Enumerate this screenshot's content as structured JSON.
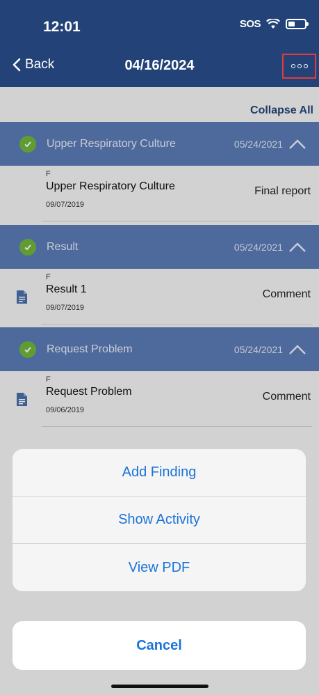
{
  "status_bar": {
    "time": "12:01",
    "carrier": "SOS"
  },
  "nav": {
    "back_label": "Back",
    "title": "04/16/2024",
    "more_icon": "ellipsis-icon"
  },
  "colors": {
    "header": "#234378",
    "section": "#5a7ab4",
    "accent": "#1a73d9",
    "check": "#6fb43a",
    "highlight": "#e23b3b"
  },
  "collapse_all_label": "Collapse All",
  "sections": [
    {
      "title": "Upper Respiratory Culture",
      "date": "05/24/2021",
      "row": {
        "code": "F",
        "title": "Upper Respiratory Culture",
        "date": "09/07/2019",
        "status": "Final report",
        "has_doc_icon": false
      }
    },
    {
      "title": "Result",
      "date": "05/24/2021",
      "row": {
        "code": "F",
        "title": "Result 1",
        "date": "09/07/2019",
        "status": "Comment",
        "has_doc_icon": true
      }
    },
    {
      "title": "Request Problem",
      "date": "05/24/2021",
      "row": {
        "code": "F",
        "title": "Request Problem",
        "date": "09/06/2019",
        "status": "Comment",
        "has_doc_icon": true
      }
    }
  ],
  "action_sheet": {
    "items": [
      "Add Finding",
      "Show Activity",
      "View PDF"
    ],
    "cancel_label": "Cancel"
  }
}
